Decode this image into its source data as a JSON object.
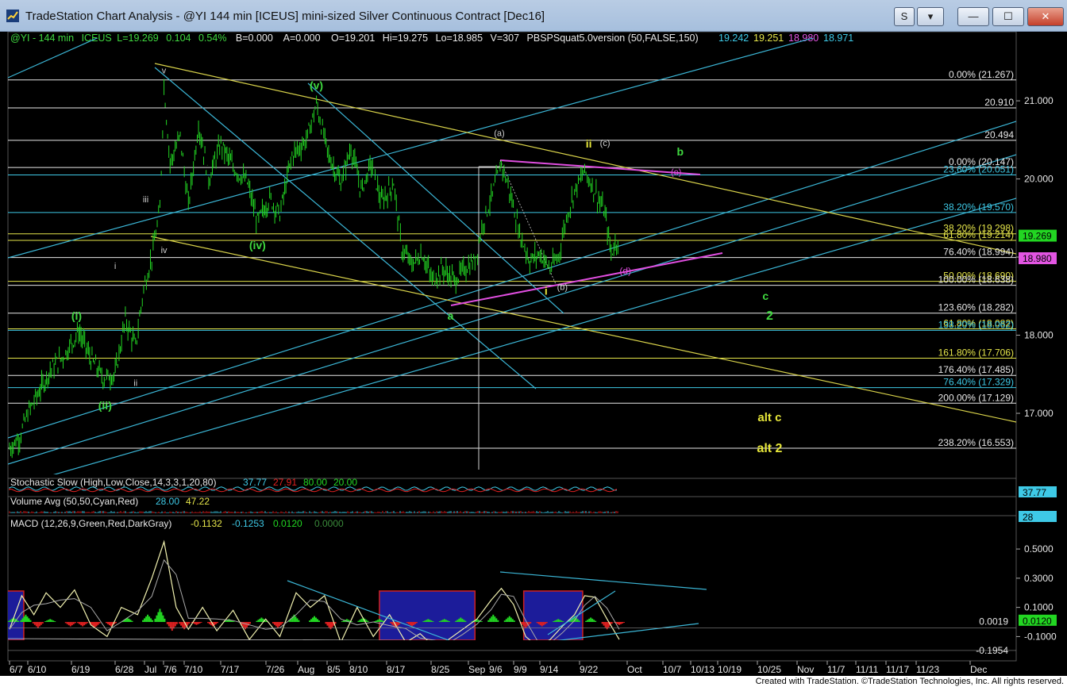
{
  "window": {
    "title": "TradeStation Chart Analysis - @YI 144 min [ICEUS] mini-sized Silver Continuous Contract [Dec16]",
    "buttons": {
      "s_label": "S",
      "dropdown_label": "▾",
      "minimize_label": "—",
      "maximize_label": "☐",
      "close_label": "✕"
    }
  },
  "header": {
    "symbol": "@YI - 144 min",
    "exchange": "ICEUS",
    "last": "L=19.269",
    "change": "0.104",
    "change_pct": "0.54%",
    "bid": "B=0.000",
    "ask": "A=0.000",
    "open": "O=19.201",
    "high": "Hi=19.275",
    "low": "Lo=18.985",
    "volume": "V=307",
    "indicator": "PBSPSquat5.0version (50,FALSE,150)",
    "indicator_values": [
      {
        "text": "19.242",
        "color": "#3ec9e6"
      },
      {
        "text": "19.251",
        "color": "#e6e64a"
      },
      {
        "text": "18.980",
        "color": "#e255e2"
      },
      {
        "text": "18.971",
        "color": "#3ec9e6"
      }
    ]
  },
  "colors": {
    "background": "#000000",
    "price_bars": "#22d622",
    "trendline": "#3bb6d6",
    "yellow_line": "#d8d24a",
    "magenta": "#e04ee0",
    "green_label": "#3fd83f",
    "yellow_label": "#e6e63a",
    "white_label": "#d0d0d0",
    "macd_line": "#f2f2b0",
    "macd_hist_up": "#22d622",
    "macd_hist_down": "#e02020",
    "box_fill": "#1c1c9a",
    "box_stroke": "#d02020"
  },
  "chart_data": {
    "type": "line",
    "title": "",
    "instrument": "@YI 144 min mini-sized Silver Continuous Contract [Dec16]",
    "x_ticks": [
      "6/7",
      "6/10",
      "6/19",
      "6/28",
      "Jul",
      "7/6",
      "7/10",
      "7/17",
      "7/26",
      "Aug",
      "8/5",
      "8/10",
      "8/17",
      "8/25",
      "Sep",
      "9/6",
      "9/9",
      "9/14",
      "9/22",
      "Oct",
      "10/7",
      "10/13",
      "10/19",
      "10/25",
      "Nov",
      "11/7",
      "11/11",
      "11/17",
      "11/23",
      "Dec"
    ],
    "y_ticks": [
      17.0,
      18.0,
      19.0,
      20.0,
      21.0
    ],
    "y_tick_labels": [
      "17.000",
      "18.000",
      "19.000",
      "20.000",
      "21.000"
    ],
    "ylim": [
      16.35,
      21.6
    ],
    "price_points": [
      {
        "x": 0,
        "y": 16.55
      },
      {
        "x": 5,
        "y": 16.7
      },
      {
        "x": 9,
        "y": 17.0
      },
      {
        "x": 14,
        "y": 17.25
      },
      {
        "x": 20,
        "y": 17.55
      },
      {
        "x": 27,
        "y": 17.75
      },
      {
        "x": 34,
        "y": 18.05
      },
      {
        "x": 40,
        "y": 17.7
      },
      {
        "x": 46,
        "y": 17.45
      },
      {
        "x": 52,
        "y": 17.5
      },
      {
        "x": 57,
        "y": 18.2
      },
      {
        "x": 62,
        "y": 17.85
      },
      {
        "x": 66,
        "y": 18.6
      },
      {
        "x": 70,
        "y": 19.0
      },
      {
        "x": 74,
        "y": 19.6
      },
      {
        "x": 76,
        "y": 21.2
      },
      {
        "x": 79,
        "y": 20.2
      },
      {
        "x": 84,
        "y": 20.55
      },
      {
        "x": 88,
        "y": 19.65
      },
      {
        "x": 93,
        "y": 20.7
      },
      {
        "x": 98,
        "y": 20.0
      },
      {
        "x": 104,
        "y": 20.45
      },
      {
        "x": 110,
        "y": 20.15
      },
      {
        "x": 117,
        "y": 19.95
      },
      {
        "x": 122,
        "y": 19.45
      },
      {
        "x": 128,
        "y": 19.75
      },
      {
        "x": 133,
        "y": 19.55
      },
      {
        "x": 139,
        "y": 20.3
      },
      {
        "x": 146,
        "y": 20.5
      },
      {
        "x": 151,
        "y": 20.95
      },
      {
        "x": 157,
        "y": 20.3
      },
      {
        "x": 163,
        "y": 19.95
      },
      {
        "x": 168,
        "y": 20.4
      },
      {
        "x": 173,
        "y": 19.85
      },
      {
        "x": 178,
        "y": 20.2
      },
      {
        "x": 183,
        "y": 19.7
      },
      {
        "x": 189,
        "y": 19.95
      },
      {
        "x": 193,
        "y": 19.1
      },
      {
        "x": 198,
        "y": 18.9
      },
      {
        "x": 203,
        "y": 19.05
      },
      {
        "x": 208,
        "y": 18.7
      },
      {
        "x": 213,
        "y": 18.85
      },
      {
        "x": 219,
        "y": 18.7
      },
      {
        "x": 224,
        "y": 18.85
      },
      {
        "x": 229,
        "y": 18.95
      },
      {
        "x": 233,
        "y": 19.45
      },
      {
        "x": 237,
        "y": 19.75
      },
      {
        "x": 242,
        "y": 20.2
      },
      {
        "x": 246,
        "y": 19.85
      },
      {
        "x": 251,
        "y": 19.3
      },
      {
        "x": 256,
        "y": 18.95
      },
      {
        "x": 261,
        "y": 19.05
      },
      {
        "x": 266,
        "y": 18.85
      },
      {
        "x": 270,
        "y": 19.0
      },
      {
        "x": 274,
        "y": 19.5
      },
      {
        "x": 278,
        "y": 19.85
      },
      {
        "x": 283,
        "y": 20.1
      },
      {
        "x": 288,
        "y": 19.85
      },
      {
        "x": 293,
        "y": 19.55
      },
      {
        "x": 296,
        "y": 19.05
      },
      {
        "x": 300,
        "y": 19.27
      }
    ],
    "levels": [
      {
        "label": "0.00% (21.267)",
        "value": 21.267,
        "color": "#e8e8e8"
      },
      {
        "label": "20.910",
        "value": 20.91,
        "color": "#e8e8e8"
      },
      {
        "label": "20.494",
        "value": 20.494,
        "color": "#e8e8e8"
      },
      {
        "label": "0.00% (20.147)",
        "value": 20.147,
        "color": "#e8e8e8"
      },
      {
        "label": "23.60% (20.051)",
        "value": 20.051,
        "color": "#3ec9e6"
      },
      {
        "label": "38.20% (19.570)",
        "value": 19.57,
        "color": "#3ec9e6"
      },
      {
        "label": "38.20% (19.298)",
        "value": 19.298,
        "color": "#e6e64a"
      },
      {
        "label": "61.80% (19.214)",
        "value": 19.214,
        "color": "#e6e64a"
      },
      {
        "label": "76.40% (18.994)",
        "value": 18.994,
        "color": "#e8e8e8"
      },
      {
        "label": "50.00% (18.690)",
        "value": 18.69,
        "color": "#e6e64a"
      },
      {
        "label": "100.00% (18.638)",
        "value": 18.638,
        "color": "#e8e8e8"
      },
      {
        "label": "123.60% (18.282)",
        "value": 18.282,
        "color": "#e8e8e8"
      },
      {
        "label": "61.80% (18.082)",
        "value": 18.082,
        "color": "#e6e64a"
      },
      {
        "label": "138.20% (18.062)",
        "value": 18.062,
        "color": "#3ec9e6"
      },
      {
        "label": "161.80% (17.706)",
        "value": 17.706,
        "color": "#e6e64a"
      },
      {
        "label": "176.40% (17.485)",
        "value": 17.485,
        "color": "#e8e8e8"
      },
      {
        "label": "76.40% (17.329)",
        "value": 17.329,
        "color": "#3ec9e6"
      },
      {
        "label": "200.00% (17.129)",
        "value": 17.129,
        "color": "#e8e8e8"
      },
      {
        "label": "238.20% (16.553)",
        "value": 16.553,
        "color": "#e8e8e8"
      }
    ],
    "price_tags": [
      {
        "text": "19.269",
        "value": 19.269,
        "bg": "#22d622",
        "fg": "#000000"
      },
      {
        "text": "18.980",
        "value": 18.98,
        "bg": "#e255e2",
        "fg": "#000000"
      }
    ],
    "wave_labels": [
      {
        "text": "v",
        "x": 76,
        "y": 21.35,
        "color": "#d0d0d0",
        "size": 11
      },
      {
        "text": "(v)",
        "x": 151,
        "y": 21.15,
        "color": "#3fd83f",
        "size": 14
      },
      {
        "text": "iii",
        "x": 67,
        "y": 19.7,
        "color": "#d0d0d0",
        "size": 11
      },
      {
        "text": "iv",
        "x": 76,
        "y": 19.05,
        "color": "#d0d0d0",
        "size": 11
      },
      {
        "text": "(iv)",
        "x": 122,
        "y": 19.1,
        "color": "#3fd83f",
        "size": 14
      },
      {
        "text": "i",
        "x": 52,
        "y": 18.85,
        "color": "#d0d0d0",
        "size": 11
      },
      {
        "text": "(i)",
        "x": 33,
        "y": 18.2,
        "color": "#3fd83f",
        "size": 14
      },
      {
        "text": "ii",
        "x": 62,
        "y": 17.35,
        "color": "#d0d0d0",
        "size": 11
      },
      {
        "text": "(ii)",
        "x": 47,
        "y": 17.05,
        "color": "#3fd83f",
        "size": 14
      },
      {
        "text": "(a)",
        "x": 241,
        "y": 20.55,
        "color": "#d0d0d0",
        "size": 11
      },
      {
        "text": "ii",
        "x": 285,
        "y": 20.4,
        "color": "#e6e63a",
        "size": 14
      },
      {
        "text": "(c)",
        "x": 293,
        "y": 20.42,
        "color": "#d0d0d0",
        "size": 11
      },
      {
        "text": "b",
        "x": 330,
        "y": 20.3,
        "color": "#3fd83f",
        "size": 14
      },
      {
        "text": "(e)",
        "x": 328,
        "y": 20.05,
        "color": "#e04ee0",
        "size": 11
      },
      {
        "text": "(d)",
        "x": 303,
        "y": 18.78,
        "color": "#e04ee0",
        "size": 12
      },
      {
        "text": "(b)",
        "x": 272,
        "y": 18.58,
        "color": "#d0d0d0",
        "size": 11
      },
      {
        "text": "i",
        "x": 264,
        "y": 18.52,
        "color": "#e6e63a",
        "size": 14
      },
      {
        "text": "a",
        "x": 217,
        "y": 18.2,
        "color": "#3fd83f",
        "size": 14
      },
      {
        "text": "c",
        "x": 372,
        "y": 18.45,
        "color": "#3fd83f",
        "size": 14
      },
      {
        "text": "2",
        "x": 374,
        "y": 18.2,
        "color": "#3fd83f",
        "size": 16
      },
      {
        "text": "alt c",
        "x": 374,
        "y": 16.9,
        "color": "#e6e63a",
        "size": 15
      },
      {
        "text": "alt 2",
        "x": 374,
        "y": 16.5,
        "color": "#e6e63a",
        "size": 16
      }
    ],
    "stochastic": {
      "label": "Stochastic Slow (High,Low,Close,14,3,3,1,20,80)",
      "values": [
        {
          "text": "37.77",
          "color": "#3ec9e6"
        },
        {
          "text": "27.91",
          "color": "#e02020"
        },
        {
          "text": "80.00",
          "color": "#22d622"
        },
        {
          "text": "20.00",
          "color": "#22d622"
        }
      ],
      "tag": "37.77"
    },
    "volume_avg": {
      "label": "Volume Avg (50,50,Cyan,Red)",
      "values": [
        {
          "text": "28.00",
          "color": "#3ec9e6"
        },
        {
          "text": "47.22",
          "color": "#e6e64a"
        }
      ],
      "tag": "28"
    },
    "macd": {
      "label": "MACD (12,26,9,Green,Red,DarkGray)",
      "values": [
        {
          "text": "-0.1132",
          "color": "#e6e64a"
        },
        {
          "text": "-0.1253",
          "color": "#3ec9e6"
        },
        {
          "text": "0.0120",
          "color": "#22d622"
        },
        {
          "text": "0.0000",
          "color": "#3a8a3a"
        }
      ],
      "y_ticks": [
        0.5,
        0.3,
        0.1,
        -0.1
      ],
      "y_tick_labels": [
        "0.5000",
        "0.3000",
        "0.1000",
        "-0.1000"
      ],
      "ylim": [
        -0.25,
        0.62
      ],
      "line_points": [
        {
          "x": 0,
          "y": -0.05
        },
        {
          "x": 6,
          "y": 0.18
        },
        {
          "x": 12,
          "y": 0.05
        },
        {
          "x": 18,
          "y": 0.2
        },
        {
          "x": 25,
          "y": 0.1
        },
        {
          "x": 32,
          "y": 0.22
        },
        {
          "x": 40,
          "y": -0.02
        },
        {
          "x": 48,
          "y": -0.1
        },
        {
          "x": 55,
          "y": 0.1
        },
        {
          "x": 63,
          "y": 0.05
        },
        {
          "x": 70,
          "y": 0.3
        },
        {
          "x": 76,
          "y": 0.55
        },
        {
          "x": 82,
          "y": 0.1
        },
        {
          "x": 88,
          "y": -0.05
        },
        {
          "x": 95,
          "y": 0.1
        },
        {
          "x": 102,
          "y": -0.06
        },
        {
          "x": 110,
          "y": 0.08
        },
        {
          "x": 118,
          "y": -0.12
        },
        {
          "x": 126,
          "y": 0.02
        },
        {
          "x": 133,
          "y": -0.1
        },
        {
          "x": 141,
          "y": 0.2
        },
        {
          "x": 148,
          "y": 0.1
        },
        {
          "x": 155,
          "y": 0.18
        },
        {
          "x": 163,
          "y": -0.14
        },
        {
          "x": 171,
          "y": 0.1
        },
        {
          "x": 179,
          "y": -0.1
        },
        {
          "x": 187,
          "y": 0.05
        },
        {
          "x": 195,
          "y": -0.14
        },
        {
          "x": 202,
          "y": -0.08
        },
        {
          "x": 209,
          "y": -0.17
        },
        {
          "x": 216,
          "y": -0.12
        },
        {
          "x": 223,
          "y": -0.05
        },
        {
          "x": 230,
          "y": 0.02
        },
        {
          "x": 237,
          "y": 0.15
        },
        {
          "x": 242,
          "y": 0.23
        },
        {
          "x": 248,
          "y": 0.12
        },
        {
          "x": 254,
          "y": -0.1
        },
        {
          "x": 260,
          "y": -0.17
        },
        {
          "x": 266,
          "y": -0.12
        },
        {
          "x": 272,
          "y": -0.03
        },
        {
          "x": 278,
          "y": 0.05
        },
        {
          "x": 283,
          "y": 0.18
        },
        {
          "x": 288,
          "y": 0.17
        },
        {
          "x": 294,
          "y": 0.02
        },
        {
          "x": 300,
          "y": -0.12
        }
      ],
      "hist": [
        {
          "x": 2,
          "v": 0.03
        },
        {
          "x": 8,
          "v": 0.05
        },
        {
          "x": 14,
          "v": -0.04
        },
        {
          "x": 20,
          "v": 0.02
        },
        {
          "x": 30,
          "v": -0.03
        },
        {
          "x": 36,
          "v": -0.03
        },
        {
          "x": 42,
          "v": -0.04
        },
        {
          "x": 50,
          "v": -0.03
        },
        {
          "x": 58,
          "v": 0.03
        },
        {
          "x": 68,
          "v": 0.05
        },
        {
          "x": 74,
          "v": 0.09
        },
        {
          "x": 80,
          "v": -0.06
        },
        {
          "x": 86,
          "v": -0.05
        },
        {
          "x": 92,
          "v": -0.02
        },
        {
          "x": 100,
          "v": -0.03
        },
        {
          "x": 108,
          "v": 0.02
        },
        {
          "x": 116,
          "v": -0.05
        },
        {
          "x": 124,
          "v": 0.03
        },
        {
          "x": 132,
          "v": -0.04
        },
        {
          "x": 140,
          "v": 0.05
        },
        {
          "x": 150,
          "v": 0.04
        },
        {
          "x": 158,
          "v": -0.05
        },
        {
          "x": 166,
          "v": 0.02
        },
        {
          "x": 174,
          "v": 0.03
        },
        {
          "x": 182,
          "v": 0.02
        },
        {
          "x": 190,
          "v": -0.04
        },
        {
          "x": 198,
          "v": -0.03
        },
        {
          "x": 206,
          "v": 0.02
        },
        {
          "x": 214,
          "v": 0.02
        },
        {
          "x": 222,
          "v": 0.03
        },
        {
          "x": 230,
          "v": 0.02
        },
        {
          "x": 238,
          "v": 0.05
        },
        {
          "x": 246,
          "v": 0.04
        },
        {
          "x": 254,
          "v": -0.04
        },
        {
          "x": 262,
          "v": -0.03
        },
        {
          "x": 270,
          "v": 0.02
        },
        {
          "x": 278,
          "v": 0.04
        },
        {
          "x": 286,
          "v": 0.03
        },
        {
          "x": 294,
          "v": -0.05
        },
        {
          "x": 300,
          "v": -0.02
        }
      ],
      "boxes": [
        {
          "x0": -5,
          "x1": 7
        },
        {
          "x0": 182,
          "x1": 229
        },
        {
          "x0": 253,
          "x1": 282
        }
      ],
      "level_tags": [
        {
          "text": "0.0019",
          "value": 0.0019,
          "boxed": false
        },
        {
          "text": "0.0120",
          "value": 0.012,
          "boxed": true
        },
        {
          "text": "-0.1954",
          "value": -0.1954,
          "boxed": false
        }
      ]
    }
  },
  "footer": {
    "credit": "Created with TradeStation. ©TradeStation Technologies, Inc. All rights reserved."
  }
}
